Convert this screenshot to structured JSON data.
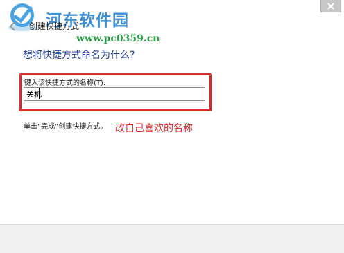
{
  "colors": {
    "watermark_blue": "#3f8fd4",
    "watermark_green": "#2a9d46",
    "heading_blue": "#1e3a8c",
    "annotation_red": "#d92c2c",
    "footer_gray": "#f0f0f0"
  },
  "watermark": {
    "title": "河东软件园",
    "url": "www.pc0359.cn"
  },
  "wizard": {
    "title": "创建快捷方式",
    "heading": "想将快捷方式命名为什么?",
    "field_label": "键入该快捷方式的名称(T):",
    "name_value": "关机",
    "finish_hint": "单击“完成”创建快捷方式。"
  },
  "annotation": {
    "text": "改自己喜欢的名称"
  },
  "icons": {
    "close": "close-icon",
    "back": "back-arrow-icon",
    "logo": "logo-icon"
  }
}
